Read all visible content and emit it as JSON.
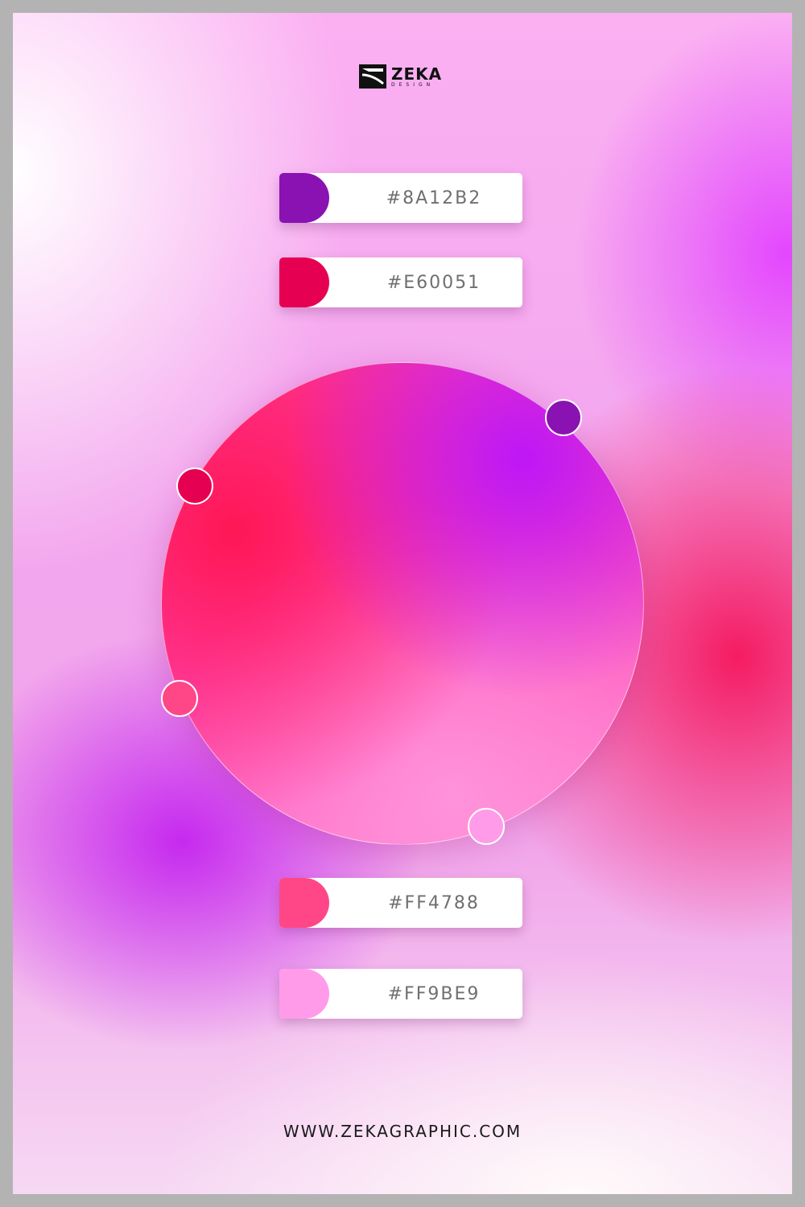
{
  "brand": {
    "logo_main": "ZEKA",
    "logo_sub": "DESIGN"
  },
  "swatches": [
    {
      "code": "#8A12B2",
      "color": "#8A12B2"
    },
    {
      "code": "#E60051",
      "color": "#E60051"
    },
    {
      "code": "#FF4788",
      "color": "#FF4788"
    },
    {
      "code": "#FF9BE9",
      "color": "#FF9BE9"
    }
  ],
  "footer": {
    "website": "WWW.ZEKAGRAPHIC.COM"
  },
  "colors": {
    "page_frame": "#b3b3b3",
    "swatch_card": "#ffffff",
    "code_text": "#6f6f6f"
  }
}
